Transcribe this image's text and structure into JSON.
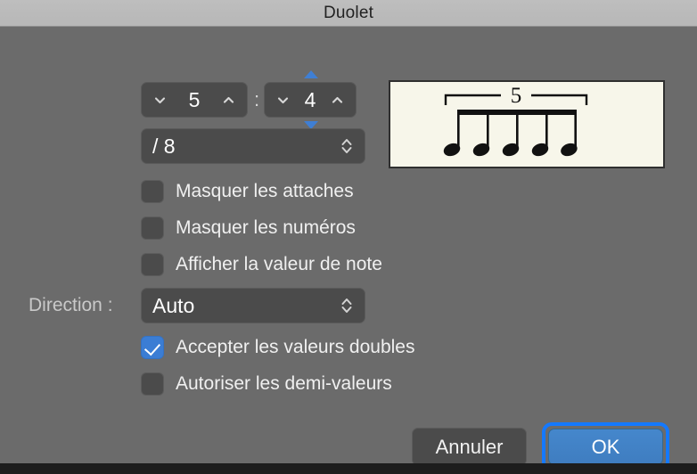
{
  "window": {
    "title": "Duolet"
  },
  "tuplet": {
    "count_value": "5",
    "base_value": "4",
    "separator": ":",
    "denominator_value": "/ 8",
    "count_decrement_icon": "chevron-down-icon",
    "count_increment_icon": "chevron-up-icon",
    "base_decrement_icon": "chevron-down-icon",
    "base_increment_icon": "chevron-up-icon",
    "denominator_popup_icon": "chevron-up-down-icon",
    "drag_up_icon": "triangle-up-icon",
    "drag_down_icon": "triangle-down-icon"
  },
  "preview": {
    "tuplet_number": "5",
    "note_count": 5,
    "note_type": "eighth-note",
    "background_color": "#f7f6ea",
    "ink_color": "#111111"
  },
  "options": [
    {
      "label": "Masquer les attaches",
      "checked": false
    },
    {
      "label": "Masquer les numéros",
      "checked": false
    },
    {
      "label": "Afficher la valeur de note",
      "checked": false
    }
  ],
  "direction": {
    "label": "Direction :",
    "value": "Auto",
    "popup_icon": "chevron-up-down-icon"
  },
  "options_lower": [
    {
      "label": "Accepter les valeurs doubles",
      "checked": true
    },
    {
      "label": "Autoriser les demi-valeurs",
      "checked": false
    }
  ],
  "buttons": {
    "cancel_label": "Annuler",
    "ok_label": "OK"
  },
  "colors": {
    "accent": "#3b7dd4",
    "focus_ring": "#1479ff",
    "window_background": "#6b6b6b",
    "titlebar": "#bebebe",
    "control": "#4b4b4b"
  }
}
